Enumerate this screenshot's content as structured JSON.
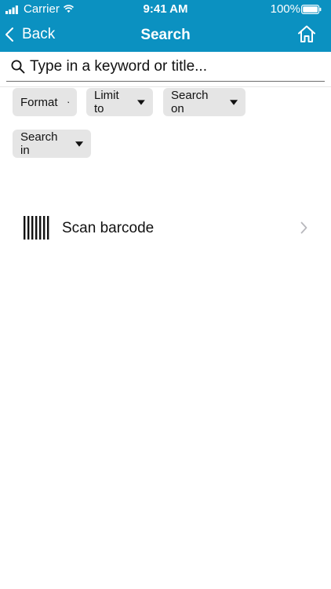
{
  "status_bar": {
    "carrier": "Carrier",
    "time": "9:41 AM",
    "battery": "100%"
  },
  "nav": {
    "back_label": "Back",
    "title": "Search",
    "home_icon": "home-icon"
  },
  "search": {
    "placeholder": "Type in a keyword or title...",
    "value": ""
  },
  "filters": [
    {
      "label": "Format"
    },
    {
      "label": "Limit to"
    },
    {
      "label": "Search on"
    },
    {
      "label": "Search in"
    }
  ],
  "scan": {
    "label": "Scan barcode",
    "icon": "barcode-icon"
  },
  "colors": {
    "header_bg": "#0b91c1",
    "chip_bg": "#e5e5e5",
    "text": "#111111",
    "chevron": "#c7c7cc"
  }
}
